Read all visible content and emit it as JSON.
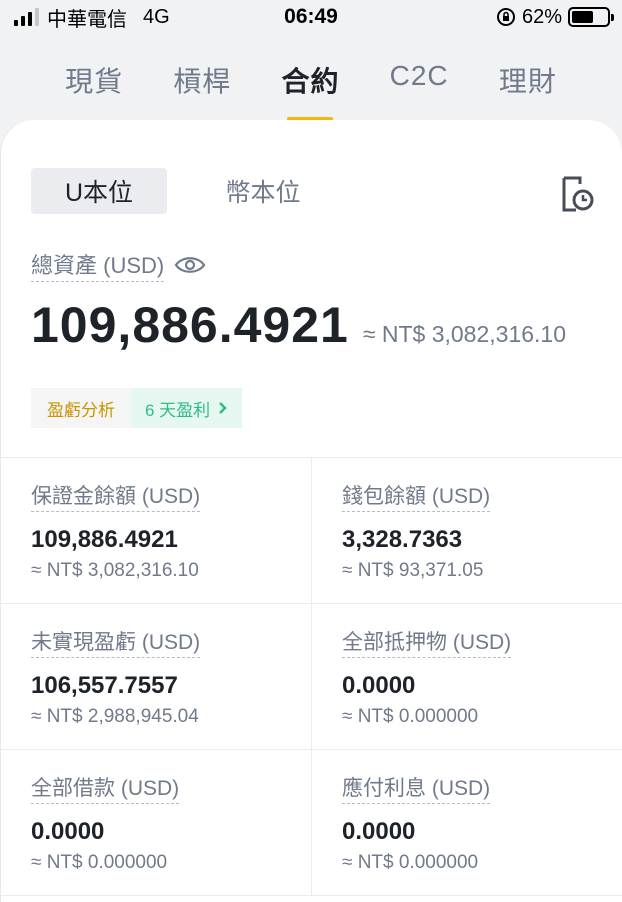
{
  "status": {
    "carrier": "中華電信",
    "network": "4G",
    "time": "06:49",
    "battery": "62%",
    "battery_level": 0.62
  },
  "tabs": [
    {
      "label": "現貨",
      "active": false
    },
    {
      "label": "槓桿",
      "active": false
    },
    {
      "label": "合約",
      "active": true
    },
    {
      "label": "C2C",
      "active": false
    },
    {
      "label": "理財",
      "active": false
    }
  ],
  "segment": {
    "u_margin": "U本位",
    "coin_margin": "幣本位"
  },
  "total": {
    "label": "總資產 (USD)",
    "value": "109,886.4921",
    "fiat": "≈ NT$  3,082,316.10"
  },
  "pnl": {
    "analysis": "盈虧分析",
    "days": "6 天盈利"
  },
  "grid": [
    [
      {
        "label": "保證金餘額 (USD)",
        "value": "109,886.4921",
        "fiat": "≈ NT$  3,082,316.10"
      },
      {
        "label": "錢包餘額 (USD)",
        "value": "3,328.7363",
        "fiat": "≈ NT$  93,371.05"
      }
    ],
    [
      {
        "label": "未實現盈虧 (USD)",
        "value": "106,557.7557",
        "fiat": "≈ NT$  2,988,945.04"
      },
      {
        "label": "全部抵押物 (USD)",
        "value": "0.0000",
        "fiat": "≈ NT$  0.000000"
      }
    ],
    [
      {
        "label": "全部借款 (USD)",
        "value": "0.0000",
        "fiat": "≈ NT$  0.000000"
      },
      {
        "label": "應付利息 (USD)",
        "value": "0.0000",
        "fiat": "≈ NT$  0.000000"
      }
    ]
  ],
  "colors": {
    "accent": "#f0b90b",
    "profit": "#2ebd85",
    "analysis": "#c99400"
  }
}
